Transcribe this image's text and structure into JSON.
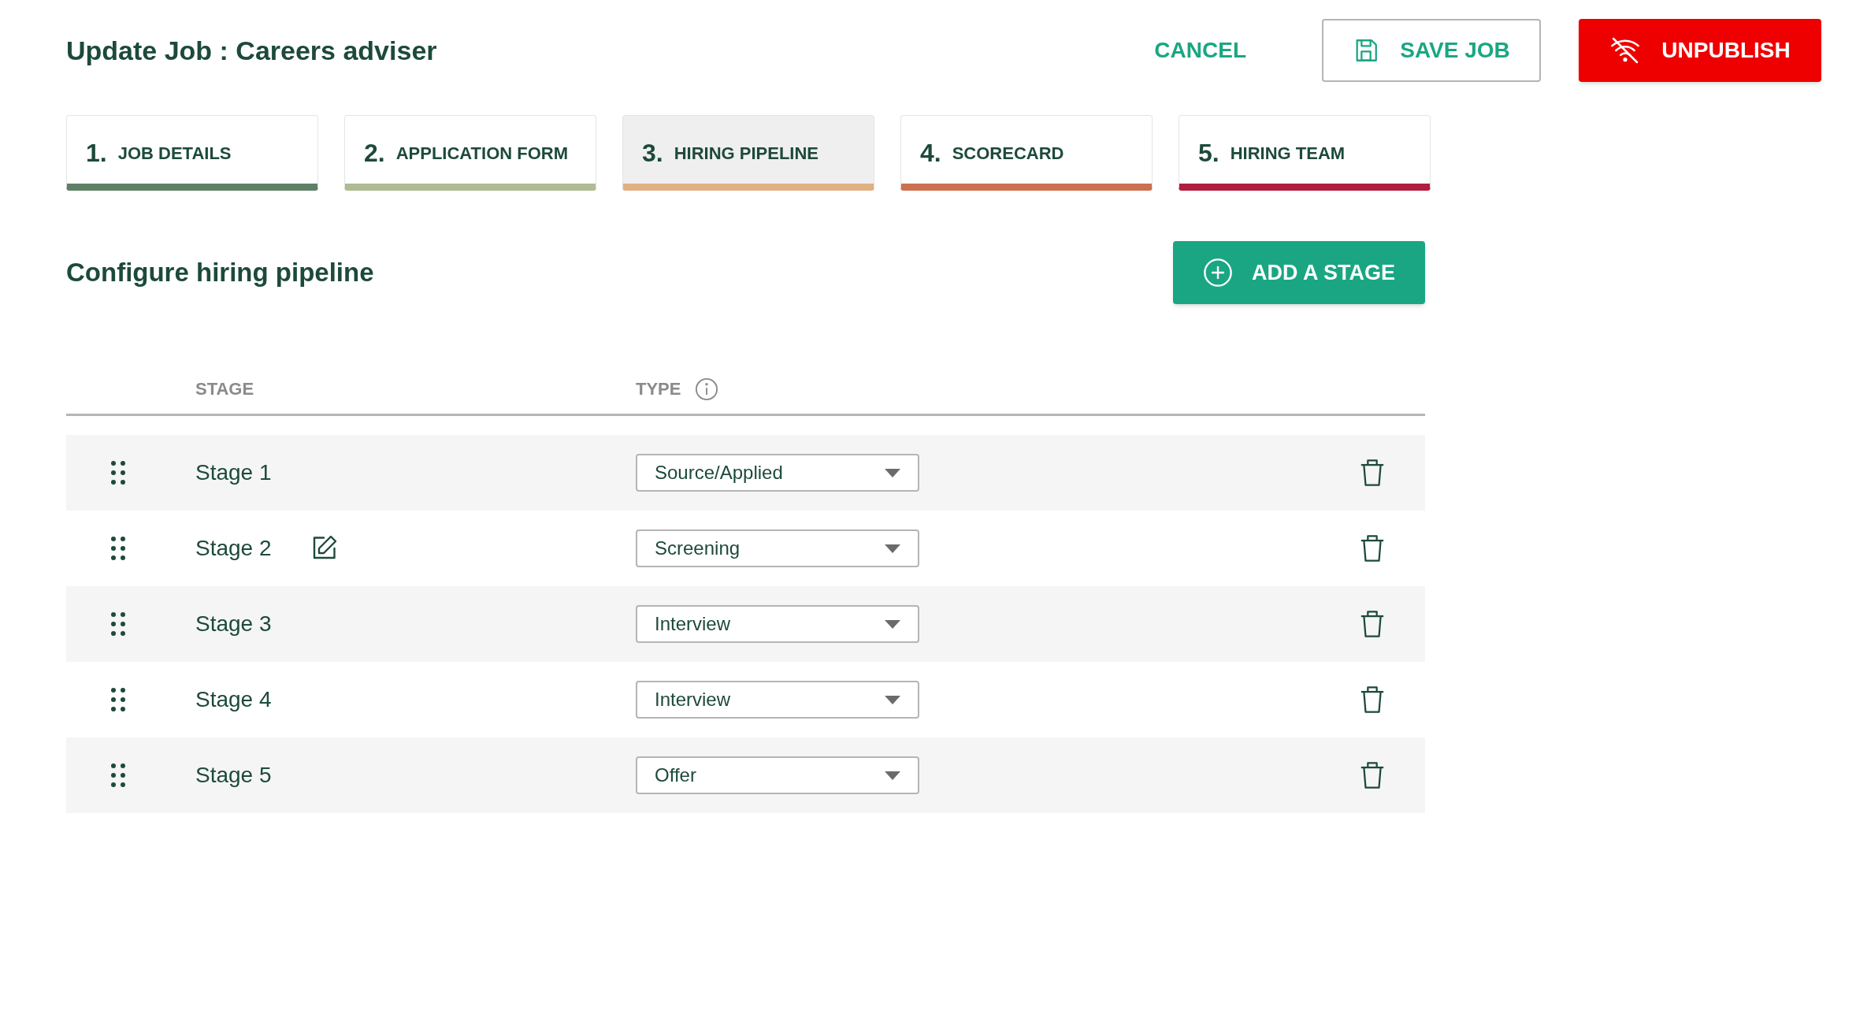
{
  "header": {
    "title": "Update Job : Careers adviser",
    "cancel": "CANCEL",
    "save": "SAVE JOB",
    "unpublish": "UNPUBLISH"
  },
  "steps": [
    {
      "number": "1.",
      "label": "JOB DETAILS",
      "selected": false,
      "color": "#5f7f67"
    },
    {
      "number": "2.",
      "label": "APPLICATION FORM",
      "selected": false,
      "color": "#aebb95"
    },
    {
      "number": "3.",
      "label": "HIRING PIPELINE",
      "selected": true,
      "color": "#e0b083"
    },
    {
      "number": "4.",
      "label": "SCORECARD",
      "selected": false,
      "color": "#cc7051"
    },
    {
      "number": "5.",
      "label": "HIRING TEAM",
      "selected": false,
      "color": "#b11d3e"
    }
  ],
  "section": {
    "title": "Configure hiring pipeline",
    "add_button": "ADD A STAGE"
  },
  "table": {
    "columns": [
      "STAGE",
      "TYPE"
    ],
    "rows": [
      {
        "stage": "Stage 1",
        "type": "Source/Applied",
        "hovered": false
      },
      {
        "stage": "Stage 2",
        "type": "Screening",
        "hovered": true
      },
      {
        "stage": "Stage 3",
        "type": "Interview",
        "hovered": false
      },
      {
        "stage": "Stage 4",
        "type": "Interview",
        "hovered": false
      },
      {
        "stage": "Stage 5",
        "type": "Offer",
        "hovered": false
      }
    ]
  }
}
